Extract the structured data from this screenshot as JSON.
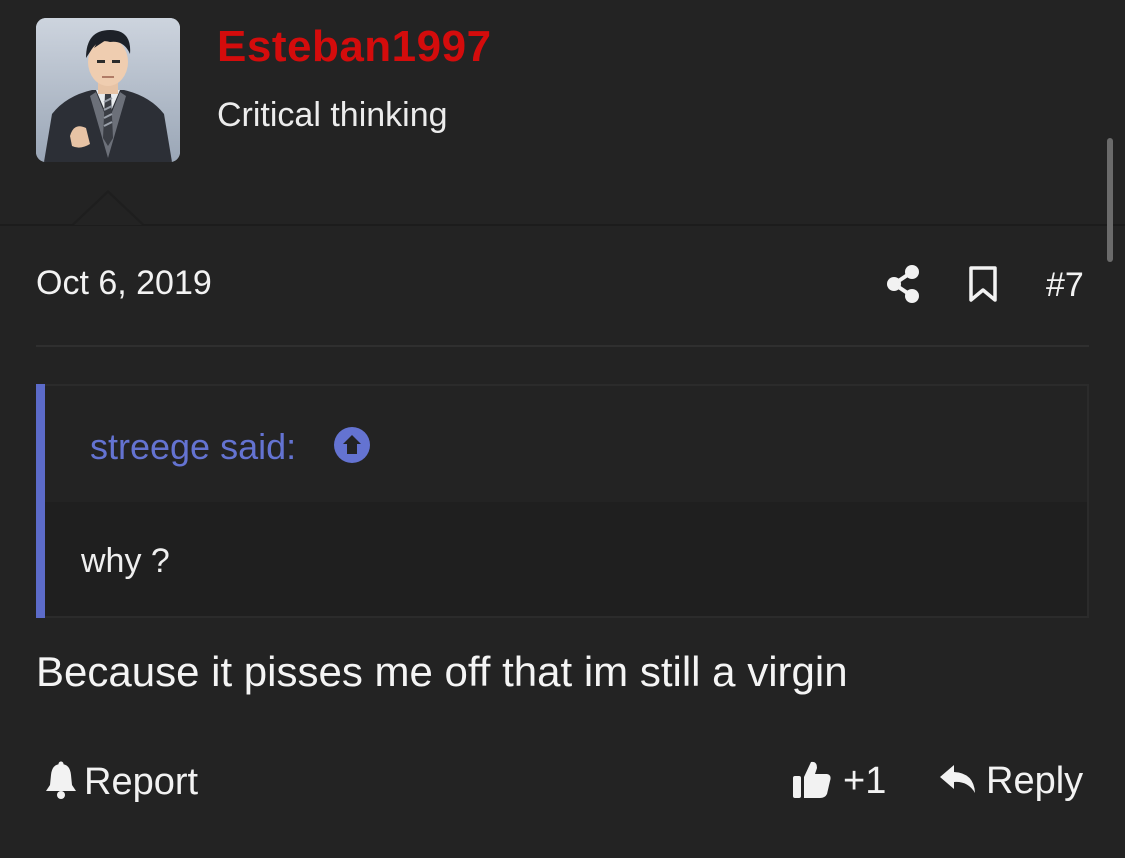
{
  "user": {
    "name": "Esteban1997",
    "title": "Critical thinking",
    "name_color": "#d40c0c"
  },
  "post": {
    "date": "Oct 6, 2019",
    "number": "#7",
    "share_icon": "share-icon",
    "bookmark_icon": "bookmark-icon"
  },
  "quote": {
    "author_label": "streege said:",
    "jump_icon": "arrow-up-circle-icon",
    "text": "why ?",
    "accent": "#5c6bc9"
  },
  "message": {
    "text": "Because it pisses me off that im still a virgin"
  },
  "actions": {
    "report_label": "Report",
    "like_count": "+1",
    "reply_label": "Reply"
  }
}
